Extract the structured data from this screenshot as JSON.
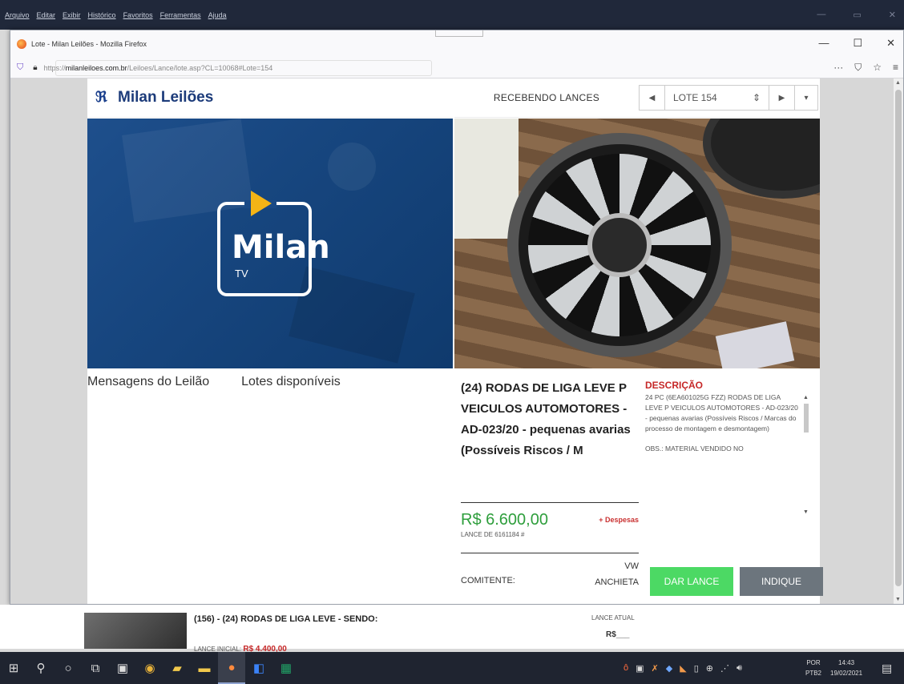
{
  "background_app": {
    "menus": [
      "Arquivo",
      "Editar",
      "Exibir",
      "Histórico",
      "Favoritos",
      "Ferramentas",
      "Ajuda"
    ]
  },
  "browser": {
    "window_title": "Lote - Milan Leilões - Mozilla Firefox",
    "url_prefix": "https://",
    "url_host": "milanleiloes.com.br",
    "url_rest": "/Leiloes/Lance/lote.asp?CL=10068#Lote=154",
    "controls": {
      "minimize": "—",
      "maximize": "☐",
      "close": "✕"
    },
    "toolbar": {
      "more": "···",
      "pocket": "⛉",
      "bookmark": "☆",
      "menu": "≡"
    }
  },
  "site": {
    "brand_name": "Milan Leilões",
    "status": "RECEBENDO LANCES",
    "lot_selector": "LOTE 154",
    "tv_logo_word": "Milan",
    "tv_logo_sub": "TV",
    "tabs": [
      "Mensagens do Leilão",
      "Lotes disponíveis"
    ]
  },
  "lot": {
    "title": "(24) RODAS DE LIGA LEVE P VEICULOS AUTOMOTORES - AD-023/20 - pequenas avarias (Possíveis Riscos / M",
    "price": "R$ 6.600,00",
    "despesas": "+ Despesas",
    "lance_de": "LANCE DE 6161184 #",
    "comitente_label": "COMITENTE:",
    "comitente_value_1": "VW",
    "comitente_value_2": "ANCHIETA",
    "description_title": "DESCRIÇÃO",
    "description_text": "24 PC (6EA601025G FZZ) RODAS DE LIGA LEVE P VEICULOS AUTOMOTORES - AD-023/20 - pequenas avarias (Possíveis Riscos / Marcas do processo de montagem e desmontagem)",
    "description_obs": "OBS.: MATERIAL VENDIDO NO",
    "btn_lance": "DAR LANCE",
    "btn_indique": "INDIQUE"
  },
  "next_lot": {
    "title": "(156) - (24) RODAS DE LIGA LEVE - SENDO:",
    "lance_inicial_label": "LANCE INICIAL:",
    "lance_inicial_value": "R$ 4.400,00",
    "lance_atual_label": "LANCE ATUAL",
    "lance_atual_value": "R$___"
  },
  "taskbar": {
    "lang_1": "POR",
    "lang_2": "PTB2",
    "time": "14:43",
    "date": "19/02/2021"
  }
}
